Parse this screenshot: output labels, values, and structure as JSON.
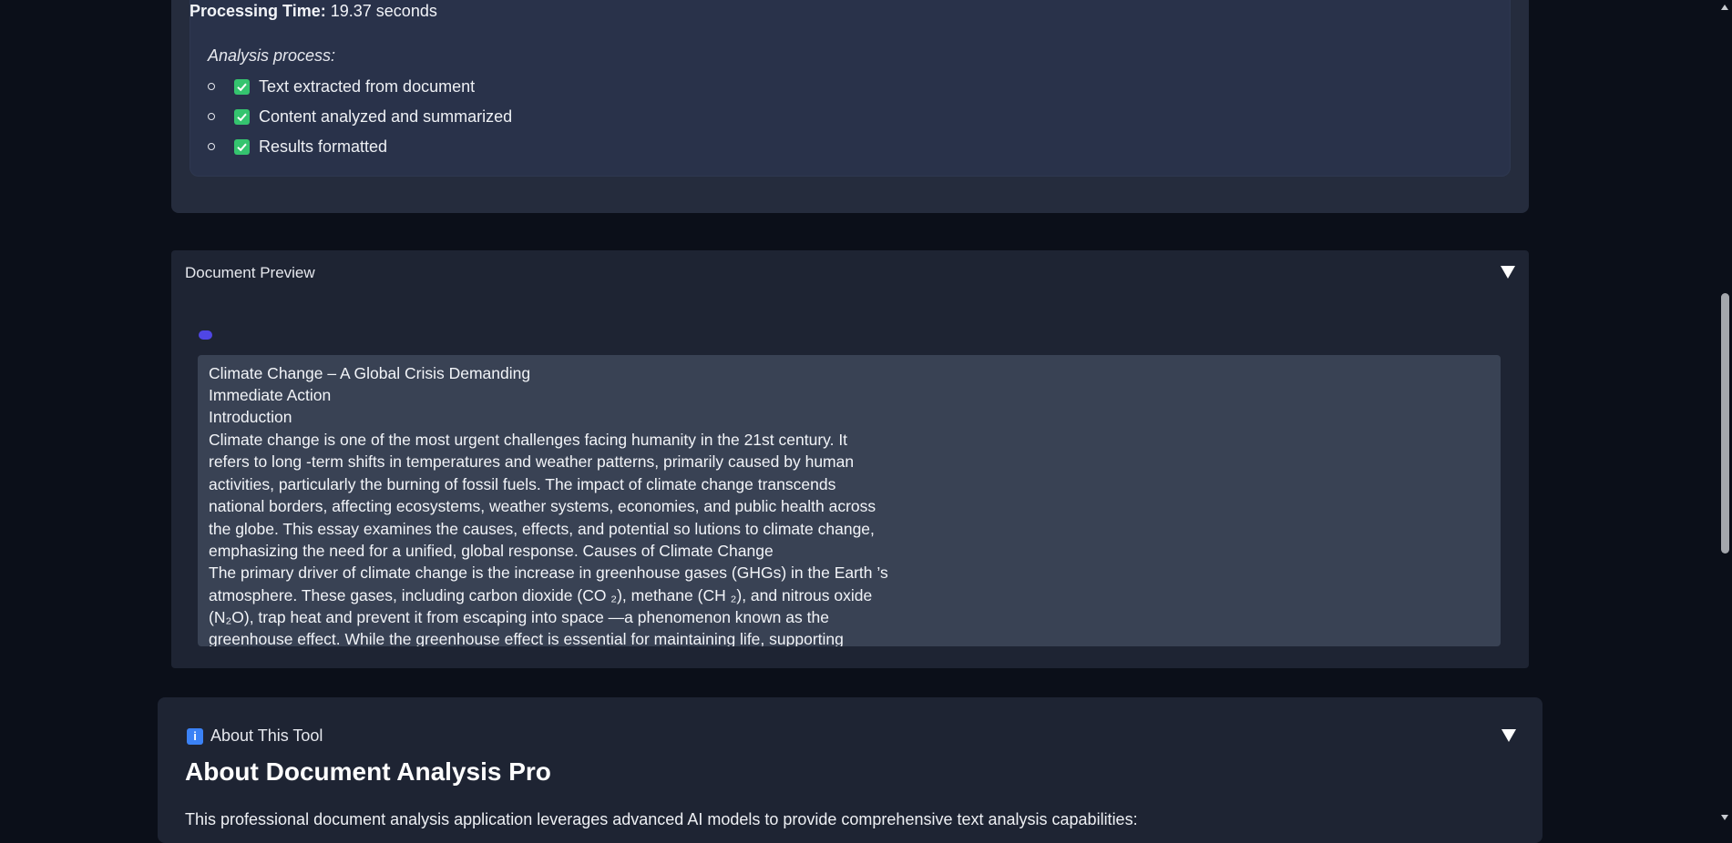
{
  "results": {
    "processing_label": "Processing Time:",
    "processing_value": "19.37 seconds",
    "analysis_label": "Analysis process:",
    "steps": [
      "Text extracted from document",
      "Content analyzed and summarized",
      "Results formatted"
    ],
    "step_icon": "check-box-icon",
    "check_color": "#35c46f"
  },
  "preview": {
    "title": "Document Preview",
    "toggle_icon": "triangle-down-icon",
    "indicator_color": "#4f46e5",
    "lines": [
      "Climate Change – A Global Crisis Demanding",
      "Immediate Action",
      "Introduction",
      "Climate change is one of the most urgent challenges facing humanity in the 21st century. It",
      "refers to long -term shifts in temperatures and weather patterns, primarily caused by human",
      "activities, particularly the burning of fossil fuels. The impact of climate change transcends",
      "national borders, affecting ecosystems, weather systems, economies, and public health across",
      "the globe. This essay examines the causes, effects, and potential so lutions to climate change,",
      "emphasizing the need for a unified, global response. Causes of Climate Change",
      "The primary driver of climate change is the increase in greenhouse gases (GHGs) in the Earth ’s",
      "atmosphere. These gases, including carbon dioxide (CO ₂), methane (CH ₂), and nitrous oxide",
      "(N₂O), trap heat and prevent it from escaping into space —a phenomenon known as the",
      "greenhouse effect. While the greenhouse effect is essential for maintaining life, supporting"
    ]
  },
  "about": {
    "header": "About This Tool",
    "header_icon": "info-icon",
    "header_icon_glyph": "i",
    "title": "About Document Analysis Pro",
    "description": "This professional document analysis application leverages advanced AI models to provide comprehensive text analysis capabilities:",
    "toggle_icon": "triangle-down-icon"
  }
}
